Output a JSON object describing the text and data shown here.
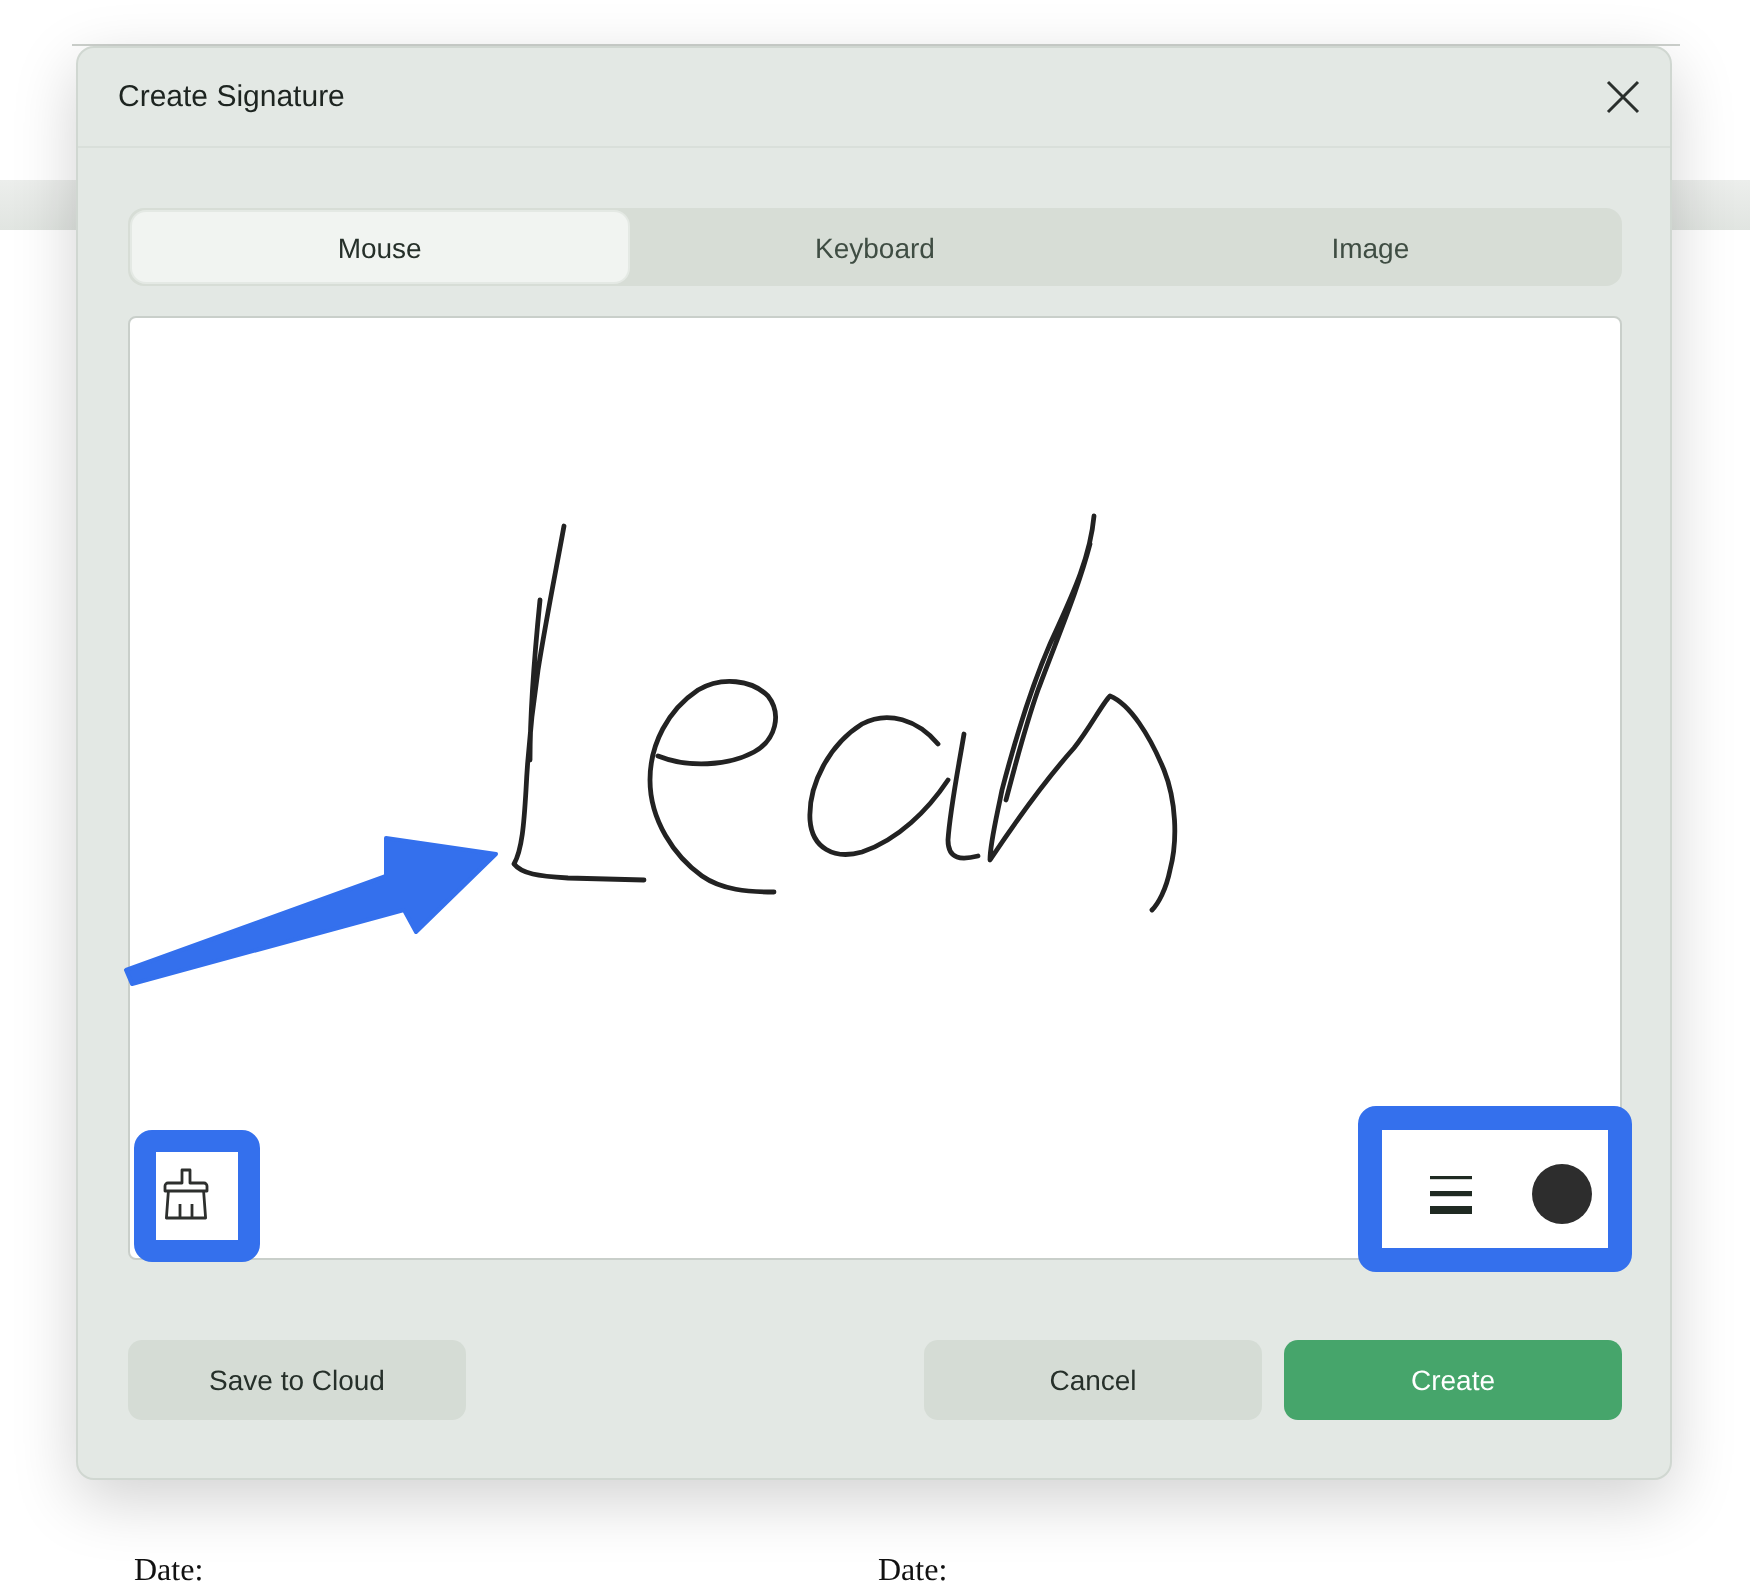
{
  "dialog": {
    "title": "Create Signature",
    "tabs": [
      {
        "label": "Mouse",
        "selected": true
      },
      {
        "label": "Keyboard",
        "selected": false
      },
      {
        "label": "Image",
        "selected": false
      }
    ],
    "footer": {
      "left_buttons": [
        {
          "label": "Save to Cloud",
          "kind": "secondary"
        }
      ],
      "right_buttons": [
        {
          "label": "Cancel",
          "kind": "secondary"
        },
        {
          "label": "Create",
          "kind": "primary"
        }
      ]
    }
  },
  "document": {
    "date_labels": [
      "Date:",
      "Date:"
    ]
  }
}
